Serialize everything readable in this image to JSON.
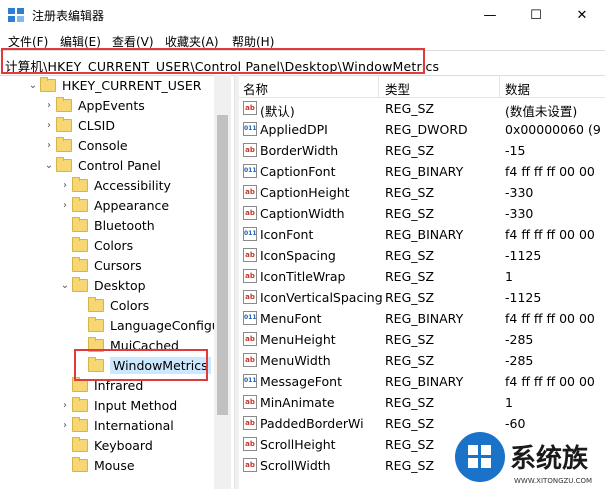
{
  "window": {
    "title": "注册表编辑器",
    "minimize_glyph": "—",
    "maximize_glyph": "☐",
    "close_glyph": "✕"
  },
  "menu": [
    "文件(F)",
    "编辑(E)",
    "查看(V)",
    "收藏夹(A)",
    "帮助(H)"
  ],
  "address": "计算机\\HKEY_CURRENT_USER\\Control Panel\\Desktop\\WindowMetrics",
  "tree": [
    {
      "label": "HKEY_CURRENT_USER",
      "level": 0,
      "chevron": "⌄"
    },
    {
      "label": "AppEvents",
      "level": 1,
      "chevron": "›"
    },
    {
      "label": "CLSID",
      "level": 1,
      "chevron": "›"
    },
    {
      "label": "Console",
      "level": 1,
      "chevron": "›"
    },
    {
      "label": "Control Panel",
      "level": 1,
      "chevron": "⌄"
    },
    {
      "label": "Accessibility",
      "level": 2,
      "chevron": "›"
    },
    {
      "label": "Appearance",
      "level": 2,
      "chevron": "›"
    },
    {
      "label": "Bluetooth",
      "level": 2,
      "chevron": ""
    },
    {
      "label": "Colors",
      "level": 2,
      "chevron": ""
    },
    {
      "label": "Cursors",
      "level": 2,
      "chevron": ""
    },
    {
      "label": "Desktop",
      "level": 2,
      "chevron": "⌄"
    },
    {
      "label": "Colors",
      "level": 3,
      "chevron": ""
    },
    {
      "label": "LanguageConfigur",
      "level": 3,
      "chevron": ""
    },
    {
      "label": "MuiCached",
      "level": 3,
      "chevron": ""
    },
    {
      "label": "WindowMetrics",
      "level": 3,
      "chevron": "",
      "selected": true
    },
    {
      "label": "Infrared",
      "level": 2,
      "chevron": ""
    },
    {
      "label": "Input Method",
      "level": 2,
      "chevron": "›"
    },
    {
      "label": "International",
      "level": 2,
      "chevron": "›"
    },
    {
      "label": "Keyboard",
      "level": 2,
      "chevron": ""
    },
    {
      "label": "Mouse",
      "level": 2,
      "chevron": ""
    }
  ],
  "columns": {
    "name": "名称",
    "type": "类型",
    "data": "数据"
  },
  "values": [
    {
      "name": "(默认)",
      "type": "REG_SZ",
      "data": "(数值未设置)",
      "kind": "ab"
    },
    {
      "name": "AppliedDPI",
      "type": "REG_DWORD",
      "data": "0x00000060 (9",
      "kind": "bin"
    },
    {
      "name": "BorderWidth",
      "type": "REG_SZ",
      "data": "-15",
      "kind": "ab"
    },
    {
      "name": "CaptionFont",
      "type": "REG_BINARY",
      "data": "f4 ff ff ff 00 00",
      "kind": "bin"
    },
    {
      "name": "CaptionHeight",
      "type": "REG_SZ",
      "data": "-330",
      "kind": "ab"
    },
    {
      "name": "CaptionWidth",
      "type": "REG_SZ",
      "data": "-330",
      "kind": "ab"
    },
    {
      "name": "IconFont",
      "type": "REG_BINARY",
      "data": "f4 ff ff ff 00 00",
      "kind": "bin"
    },
    {
      "name": "IconSpacing",
      "type": "REG_SZ",
      "data": "-1125",
      "kind": "ab"
    },
    {
      "name": "IconTitleWrap",
      "type": "REG_SZ",
      "data": "1",
      "kind": "ab"
    },
    {
      "name": "IconVerticalSpacing",
      "type": "REG_SZ",
      "data": "-1125",
      "kind": "ab"
    },
    {
      "name": "MenuFont",
      "type": "REG_BINARY",
      "data": "f4 ff ff ff 00 00",
      "kind": "bin"
    },
    {
      "name": "MenuHeight",
      "type": "REG_SZ",
      "data": "-285",
      "kind": "ab"
    },
    {
      "name": "MenuWidth",
      "type": "REG_SZ",
      "data": "-285",
      "kind": "ab"
    },
    {
      "name": "MessageFont",
      "type": "REG_BINARY",
      "data": "f4 ff ff ff 00 00",
      "kind": "bin"
    },
    {
      "name": "MinAnimate",
      "type": "REG_SZ",
      "data": "1",
      "kind": "ab"
    },
    {
      "name": "PaddedBorderWi",
      "type": "REG_SZ",
      "data": "-60",
      "kind": "ab"
    },
    {
      "name": "ScrollHeight",
      "type": "REG_SZ",
      "data": "",
      "kind": "ab"
    },
    {
      "name": "ScrollWidth",
      "type": "REG_SZ",
      "data": "",
      "kind": "ab"
    }
  ],
  "watermark": {
    "brand": "系统族",
    "url": "WWW.XITONGZU.COM"
  },
  "colors": {
    "highlight": "#e03a3a",
    "selection": "#cce8ff",
    "folder": "#f7d774",
    "accent": "#0078d7"
  }
}
